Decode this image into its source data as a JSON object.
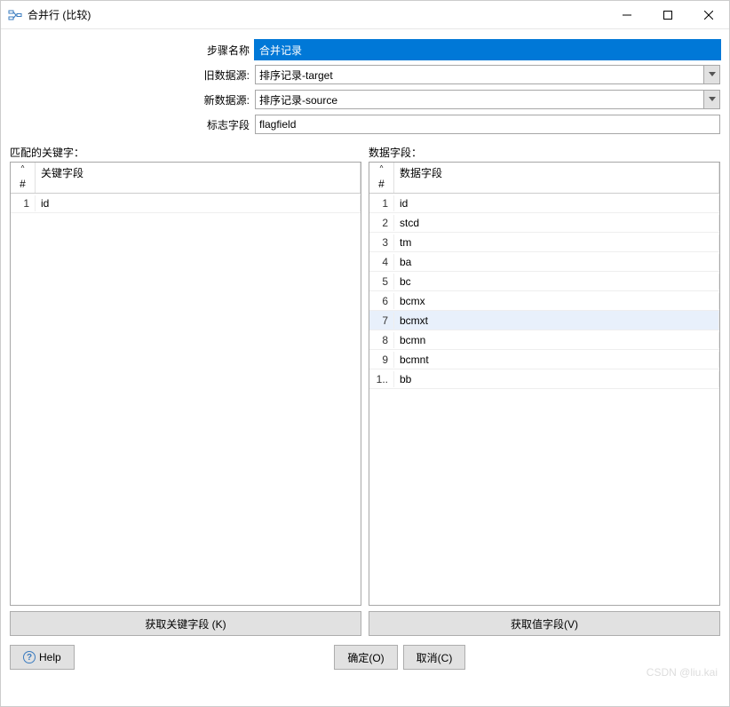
{
  "window": {
    "title": "合并行 (比较)"
  },
  "form": {
    "step_name_label": "步骤名称",
    "step_name_value": "合并记录",
    "old_source_label": "旧数据源:",
    "old_source_value": "排序记录-target",
    "new_source_label": "新数据源:",
    "new_source_value": "排序记录-source",
    "flag_field_label": "标志字段",
    "flag_field_value": "flagfield"
  },
  "left_panel": {
    "title": "匹配的关键字：",
    "header_num": "#",
    "header_field": "关键字段",
    "rows": [
      {
        "n": "1",
        "v": "id"
      }
    ],
    "button": "获取关键字段 (K)"
  },
  "right_panel": {
    "title": "数据字段：",
    "header_num": "#",
    "header_field": "数据字段",
    "rows": [
      {
        "n": "1",
        "v": "id"
      },
      {
        "n": "2",
        "v": "stcd"
      },
      {
        "n": "3",
        "v": "tm"
      },
      {
        "n": "4",
        "v": "ba"
      },
      {
        "n": "5",
        "v": "bc"
      },
      {
        "n": "6",
        "v": "bcmx"
      },
      {
        "n": "7",
        "v": "bcmxt",
        "hl": true
      },
      {
        "n": "8",
        "v": "bcmn"
      },
      {
        "n": "9",
        "v": "bcmnt"
      },
      {
        "n": "1..",
        "v": "bb"
      }
    ],
    "button": "获取值字段(V)"
  },
  "footer": {
    "help": "Help",
    "ok": "确定(O)",
    "cancel": "取消(C)"
  },
  "watermark": "CSDN @liu.kai"
}
